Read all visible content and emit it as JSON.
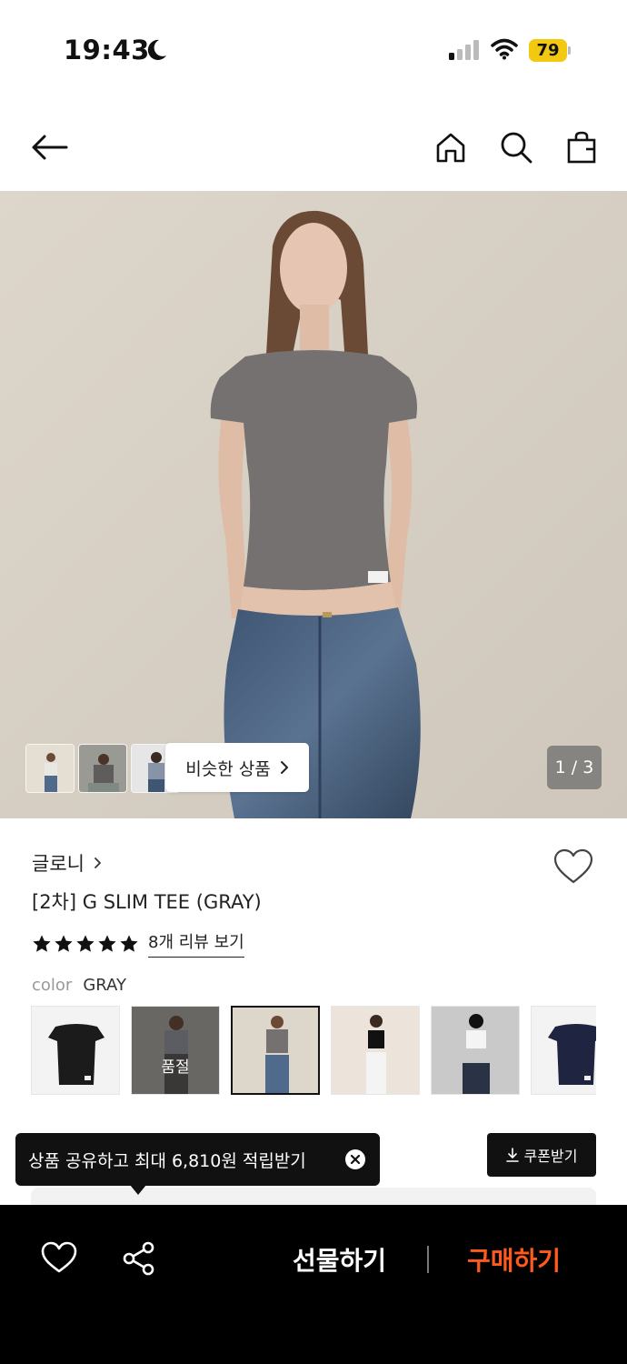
{
  "status_bar": {
    "time": "19:43",
    "battery": "79"
  },
  "header": {
    "icons": [
      "back-arrow-icon",
      "home-icon",
      "search-icon",
      "shopping-bag-icon"
    ]
  },
  "hero": {
    "similar_label": "비슷한 상품",
    "page_counter": "1 / 3"
  },
  "product": {
    "brand": "글로니",
    "title": "[2차] G SLIM TEE (GRAY)",
    "rating_stars": 5,
    "review_link": "8개 리뷰 보기",
    "color_label": "color",
    "color_value": "GRAY",
    "swatches": [
      {
        "color": "#1b1b1b"
      },
      {
        "color": "#7b7d85",
        "status": "품절"
      },
      {
        "color": "#7a7773",
        "selected": true
      },
      {
        "color": "#111111"
      },
      {
        "color": "#f4f4f4"
      },
      {
        "color": "#1f2440"
      }
    ]
  },
  "share_tooltip": {
    "text": "상품 공유하고 최대 6,810원 적립받기"
  },
  "coupon": {
    "label": "쿠폰받기"
  },
  "bottom_bar": {
    "gift_label": "선물하기",
    "buy_label": "구매하기"
  },
  "colors": {
    "buy_accent": "#ff5a1e",
    "battery": "#f2c811"
  }
}
